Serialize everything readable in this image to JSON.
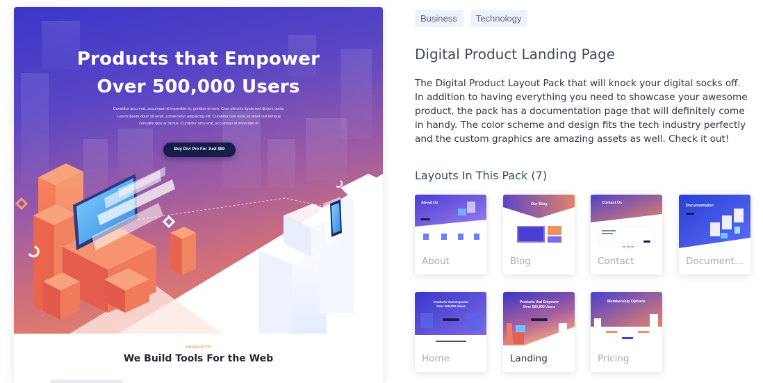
{
  "preview": {
    "hero_title_line1": "Products that Empower",
    "hero_title_line2": "Over 500,000 Users",
    "hero_body_line1": "Curabitur arcu erat, accumsan id imperdiet et, porttitor at sem. Cras ultricies ligula sed dictum porta.",
    "hero_body_line2": "Lorem ipsum dolor sit amet, consectetur adipiscing elit. Curabitur non nulla sit amet nisl tempus",
    "hero_body_line3": "convallis quis ac lectus. Curabitur arcu erat, accumsan id imperdiet et",
    "cta_label": "Buy Divi Pro For Just $89",
    "products_label": "PRODUCTS",
    "products_title": "We Build Tools For the Web"
  },
  "tags": [
    "Business",
    "Technology"
  ],
  "title": "Digital Product Landing Page",
  "description": "The Digital Product Layout Pack that will knock your digital socks off. In addition to having everything you need to showcase your awesome product, the pack has a documentation page that will definitely come in handy. The color scheme and design fits the tech industry perfectly and the custom graphics are amazing assets as well. Check it out!",
  "layouts_heading": "Layouts In This Pack (7)",
  "layouts": [
    {
      "label": "About",
      "thumb_title": "About Us",
      "active": false
    },
    {
      "label": "Blog",
      "thumb_title": "Our Blog",
      "active": false
    },
    {
      "label": "Contact",
      "thumb_title": "Contact Us",
      "active": false
    },
    {
      "label": "Document...",
      "thumb_title": "Documentation",
      "active": false
    },
    {
      "label": "Home",
      "thumb_title": "Products that Empower Over 500,000 Users",
      "active": false
    },
    {
      "label": "Landing",
      "thumb_title": "Products that Empower Over 500,000 Users",
      "active": true
    },
    {
      "label": "Pricing",
      "thumb_title": "Membership Options",
      "active": false
    }
  ],
  "colors": {
    "hero_gradient_start": "#3b36c9",
    "hero_gradient_end": "#f29f7e",
    "accent_orange": "#f0905e",
    "cta_navy": "#171d4a",
    "tag_bg": "#eef2f8"
  }
}
